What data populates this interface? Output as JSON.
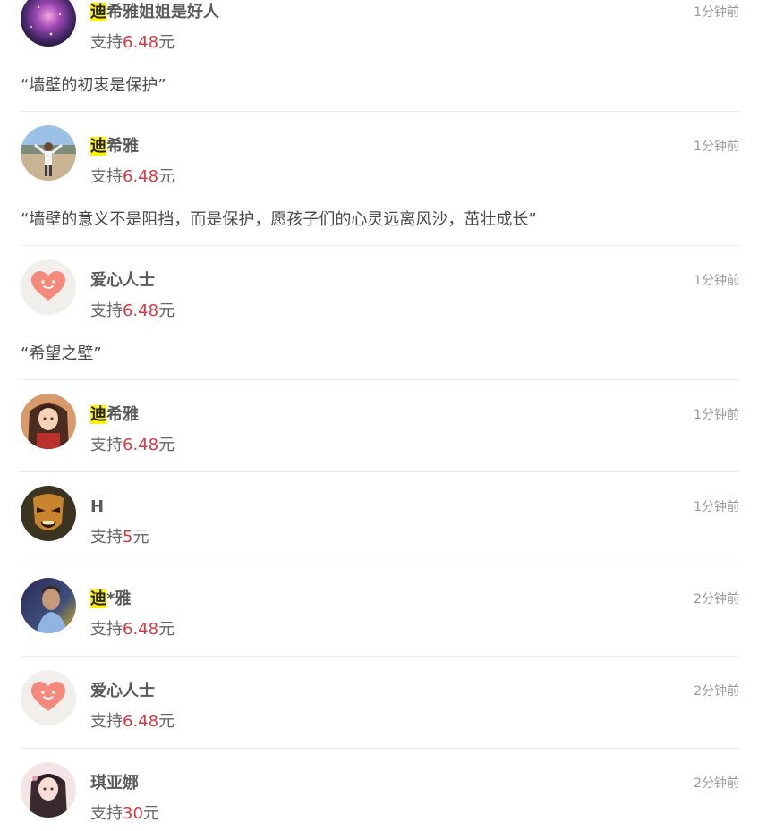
{
  "support_prefix": "支持",
  "currency_suffix": "元",
  "items": [
    {
      "name_highlight": "迪",
      "name_rest": "希雅姐姐是好人",
      "amount": "6.48",
      "time": "1分钟前",
      "message": "“墙壁的初衷是保护”",
      "avatar": "galaxy-avatar-icon"
    },
    {
      "name_highlight": "迪",
      "name_rest": "希雅",
      "amount": "6.48",
      "time": "1分钟前",
      "message": "“墙壁的意义不是阻挡，而是保护，愿孩子们的心灵远离风沙，茁壮成长”",
      "avatar": "person-landscape-avatar-icon"
    },
    {
      "name_highlight": "",
      "name_rest": "爱心人士",
      "amount": "6.48",
      "time": "1分钟前",
      "message": "“希望之壁”",
      "avatar": "heart-avatar-icon"
    },
    {
      "name_highlight": "迪",
      "name_rest": "希雅",
      "amount": "6.48",
      "time": "1分钟前",
      "message": "",
      "avatar": "anime-girl-avatar-icon"
    },
    {
      "name_highlight": "",
      "name_rest": "H",
      "amount": "5",
      "time": "1分钟前",
      "message": "",
      "avatar": "mask-avatar-icon"
    },
    {
      "name_highlight": "迪",
      "name_rest": "*雅",
      "amount": "6.48",
      "time": "2分钟前",
      "message": "",
      "avatar": "athlete-avatar-icon"
    },
    {
      "name_highlight": "",
      "name_rest": "爱心人士",
      "amount": "6.48",
      "time": "2分钟前",
      "message": "",
      "avatar": "heart-avatar-icon"
    },
    {
      "name_highlight": "",
      "name_rest": "琪亚娜",
      "amount": "30",
      "time": "2分钟前",
      "message": "",
      "avatar": "anime-character-avatar-icon"
    }
  ]
}
